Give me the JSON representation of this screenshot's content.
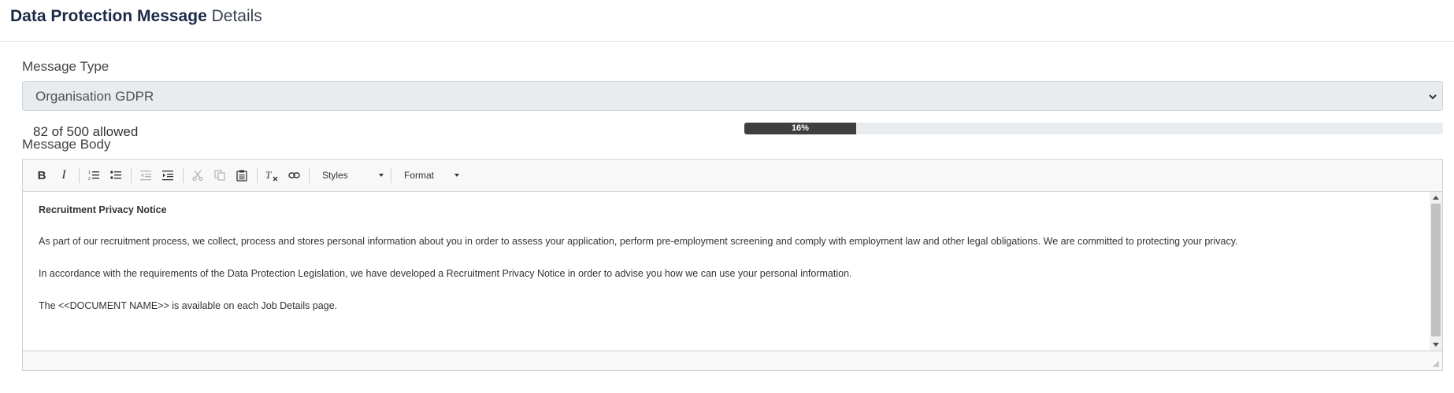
{
  "header": {
    "title_strong": "Data Protection Message",
    "title_light": "Details"
  },
  "message_type": {
    "label": "Message Type",
    "selected": "Organisation GDPR"
  },
  "counter": {
    "text": "82 of 500 allowed",
    "percent_label": "16%",
    "percent": 16
  },
  "message_body": {
    "label": "Message Body",
    "toolbar": {
      "bold": "B",
      "italic": "I",
      "styles": "Styles",
      "format": "Format"
    },
    "content": {
      "title": "Recruitment Privacy Notice",
      "p1": "As part of our recruitment process, we collect, process and stores personal information about you in order to assess your application, perform pre-employment screening and comply with employment law and other legal obligations.  We are committed to protecting your privacy.",
      "p2": "In accordance with the requirements of the Data Protection Legislation, we have developed a Recruitment Privacy Notice in order to advise you how we can use your personal information.",
      "p3": "The <<DOCUMENT NAME>> is available on each Job Details page."
    }
  },
  "icons": {
    "select": "chevron-down-icon",
    "toolbar": [
      "bold-icon",
      "italic-icon",
      "numbered-list-icon",
      "bulleted-list-icon",
      "decrease-indent-icon",
      "increase-indent-icon",
      "cut-icon",
      "copy-icon",
      "paste-icon",
      "remove-format-icon",
      "link-icon"
    ]
  },
  "colors": {
    "title": "#1c2a48",
    "progress_bar": "#3f3f3f",
    "select_bg": "#e9ecef"
  }
}
